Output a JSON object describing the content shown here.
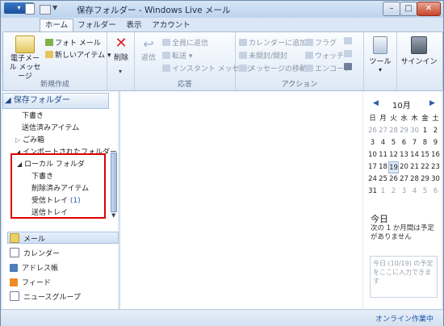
{
  "window": {
    "title": "保存フォルダー - Windows Live メール"
  },
  "tabs": [
    {
      "label": "ホーム"
    },
    {
      "label": "フォルダー"
    },
    {
      "label": "表示"
    },
    {
      "label": "アカウント"
    }
  ],
  "ribbon": {
    "new_group": {
      "label": "新規作成",
      "email_message": "電子メール メッセージ",
      "photo_mail": "フォト メール",
      "new_item": "新しいアイテム"
    },
    "delete_group": {
      "delete": "削除"
    },
    "respond_group": {
      "label": "応答",
      "reply": "返信",
      "reply_all": "全員に返信",
      "forward": "転送",
      "instant_message": "インスタント メッセージ"
    },
    "actions_group": {
      "label": "アクション",
      "add_to_calendar": "カレンダーに追加",
      "unread_read": "未開封/開封",
      "move_message": "メッセージの移動",
      "flag": "フラグ",
      "watch": "ウォッチ",
      "encoding": "エンコード"
    },
    "tools": "ツール",
    "signin": "サインイン"
  },
  "folders": {
    "header": "保存フォルダー",
    "items": [
      {
        "label": "下書き"
      },
      {
        "label": "送信済みアイテム"
      },
      {
        "label": "ごみ箱"
      },
      {
        "label": "インポートされたフォルダー"
      },
      {
        "label": "ローカル フォルダ"
      },
      {
        "label": "下書き"
      },
      {
        "label": "削除済みアイテム"
      },
      {
        "label": "受信トレイ",
        "count": "(1)"
      },
      {
        "label": "送信トレイ"
      }
    ]
  },
  "nav": [
    {
      "label": "メール"
    },
    {
      "label": "カレンダー"
    },
    {
      "label": "アドレス帳"
    },
    {
      "label": "フィード"
    },
    {
      "label": "ニュースグループ"
    }
  ],
  "calendar": {
    "month": "10月",
    "weekdays": [
      "日",
      "月",
      "火",
      "水",
      "木",
      "金",
      "土"
    ],
    "rows": [
      [
        "26",
        "27",
        "28",
        "29",
        "30",
        "1",
        "2"
      ],
      [
        "3",
        "4",
        "5",
        "6",
        "7",
        "8",
        "9"
      ],
      [
        "10",
        "11",
        "12",
        "13",
        "14",
        "15",
        "16"
      ],
      [
        "17",
        "18",
        "19",
        "20",
        "21",
        "22",
        "23"
      ],
      [
        "24",
        "25",
        "26",
        "27",
        "28",
        "29",
        "30"
      ],
      [
        "31",
        "1",
        "2",
        "3",
        "4",
        "5",
        "6"
      ]
    ]
  },
  "today": {
    "title": "今日",
    "text": "次の 1 か月間は予定がありません",
    "note_placeholder": "今日 (10/19) の予定をここに入力できます"
  },
  "status": "オンライン作業中"
}
